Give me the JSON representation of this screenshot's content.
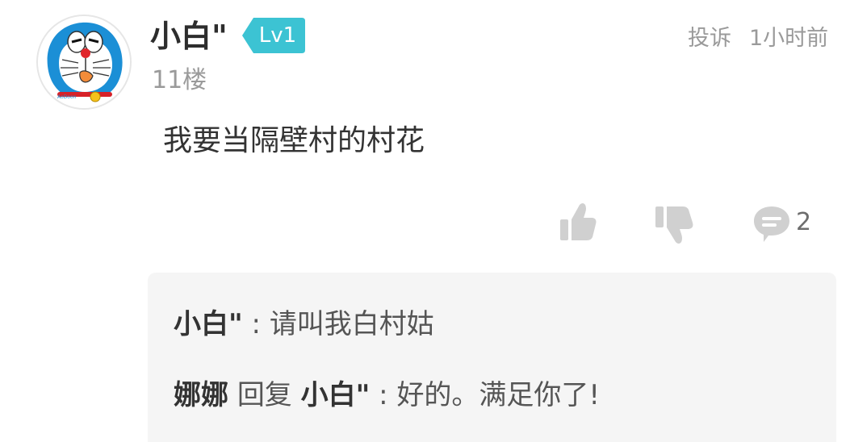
{
  "comment": {
    "author": "小白\"",
    "level": "Lv1",
    "floor": "11楼",
    "report_label": "投诉",
    "time": "1小时前",
    "text": "我要当隔壁村的村花",
    "avatar_brand": "AoDoon"
  },
  "actions": {
    "like_icon": "thumbs-up-icon",
    "dislike_icon": "thumbs-down-icon",
    "reply_icon": "comment-bubble-icon",
    "reply_count": "2"
  },
  "replies": [
    {
      "author": "小白\"",
      "separator": ":",
      "text": "请叫我白村姑"
    },
    {
      "author": "娜娜",
      "reply_word": "回复",
      "target": "小白\"",
      "separator": ":",
      "text": "好的。满足你了!"
    }
  ],
  "colors": {
    "level_badge": "#3cc3d3",
    "meta_gray": "#9a9a9a",
    "icon_gray": "#d0d0d0",
    "reply_bg": "#f5f5f5"
  }
}
